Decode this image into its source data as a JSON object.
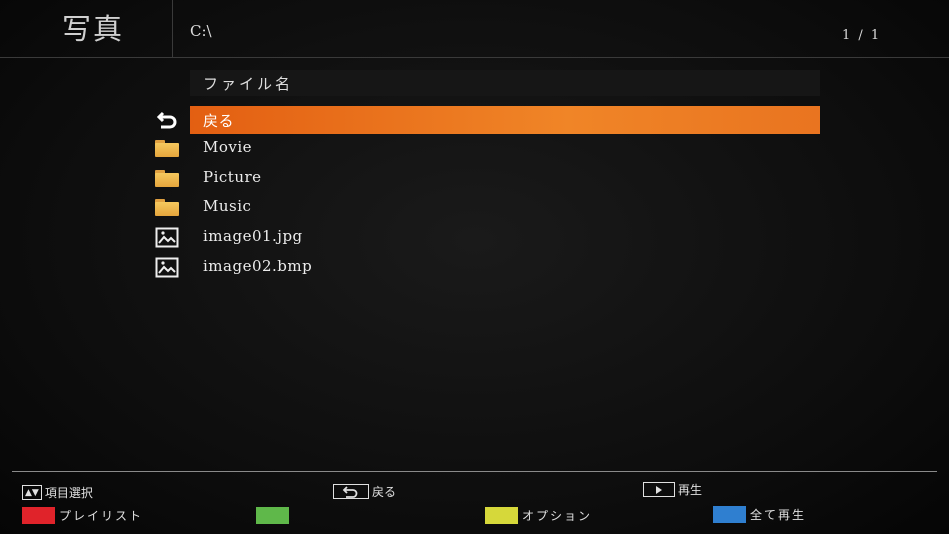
{
  "header": {
    "app_title": "写真",
    "path": "C:\\",
    "page_counter": "1 / 1"
  },
  "list": {
    "column_header": "ファイル名",
    "items": [
      {
        "label": "戻る",
        "icon": "back-arrow-icon",
        "selected": true
      },
      {
        "label": "Movie",
        "icon": "folder-icon"
      },
      {
        "label": "Picture",
        "icon": "folder-icon"
      },
      {
        "label": "Music",
        "icon": "folder-icon"
      },
      {
        "label": "image01.jpg",
        "icon": "image-file-icon"
      },
      {
        "label": "image02.bmp",
        "icon": "image-file-icon"
      }
    ]
  },
  "footer": {
    "select_key": "▲▼",
    "select_label": "項目選択",
    "back_label": "戻る",
    "play_label": "再生",
    "red_label": "プレイリスト",
    "green_label": "",
    "yellow_label": "オプション",
    "blue_label": "全て再生"
  },
  "colors": {
    "highlight": "#ef7a22",
    "red": "#e0232a",
    "green": "#5fb84a",
    "yellow": "#d6d83a",
    "blue": "#2f7fd0"
  }
}
